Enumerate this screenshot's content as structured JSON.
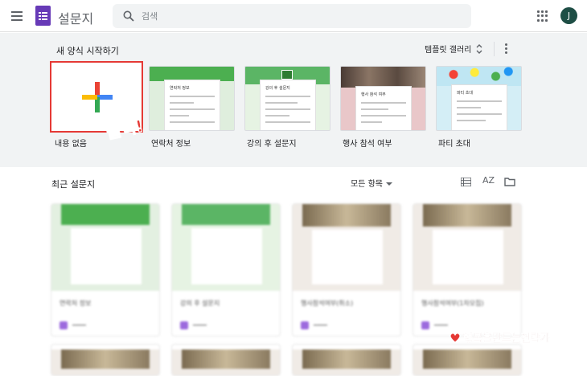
{
  "header": {
    "app_title": "설문지",
    "search_placeholder": "검색",
    "avatar_initial": "J"
  },
  "templates": {
    "section_title": "새 양식 시작하기",
    "gallery_label": "템플릿 갤러리",
    "items": [
      {
        "label": "내용 없음"
      },
      {
        "label": "연락처 정보",
        "card_title": "연락처 정보"
      },
      {
        "label": "강의 후 설문지",
        "card_title": "강의 후 설문지"
      },
      {
        "label": "행사 참석 여부",
        "card_title": "행사 참석 여부"
      },
      {
        "label": "파티 초대",
        "card_title": "파티 초대"
      }
    ],
    "annotation": "클릭!"
  },
  "recent": {
    "section_title": "최근 설문지",
    "owner_filter": "모든 항목",
    "sort_label": "AZ",
    "docs": [
      {
        "title": "연락처 정보"
      },
      {
        "title": "강의 후 설문지"
      },
      {
        "title": "행사참석여부(취소)"
      },
      {
        "title": "행사참석여부(1차모집)"
      }
    ]
  },
  "watermark": "행복을만드는전략가",
  "colors": {
    "forms_purple": "#673ab7",
    "annotation_red": "#e53935",
    "avatar_bg": "#1e4e45"
  }
}
